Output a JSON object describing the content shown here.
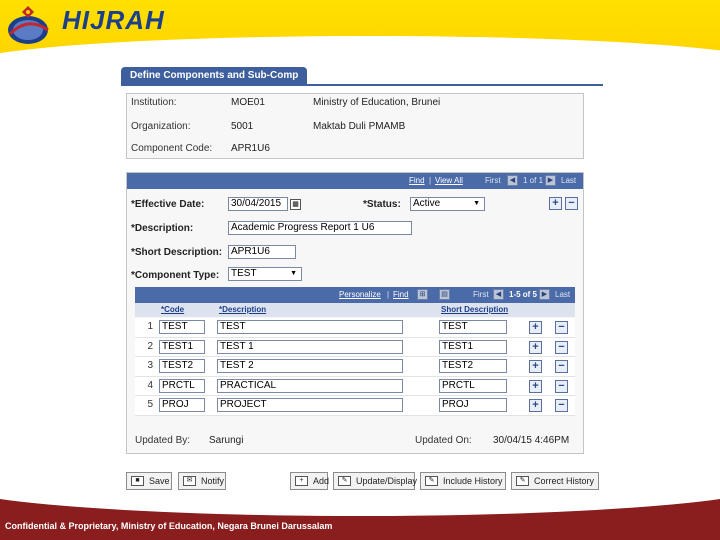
{
  "branding": {
    "logo_text": "HIJRAH",
    "footer_text": "Confidential & Proprietary, Ministry of Education, Negara Brunei Darussalam",
    "colors": {
      "banner": "#ffd400",
      "footer": "#8a1d1d",
      "tab": "#3d5f9e"
    }
  },
  "page": {
    "tab_label": "Define Components and Sub-Comp"
  },
  "keys": {
    "institution_label": "Institution:",
    "institution_code": "MOE01",
    "institution_name": "Ministry of Education, Brunei",
    "organization_label": "Organization:",
    "organization_code": "5001",
    "organization_name": "Maktab Duli PMAMB",
    "component_code_label": "Component Code:",
    "component_code": "APR1U6"
  },
  "effdt_nav": {
    "find": "Find",
    "view_all": "View All",
    "first": "First",
    "counter": "1 of 1",
    "last": "Last"
  },
  "form": {
    "effective_date_label": "*Effective Date:",
    "effective_date": "30/04/2015",
    "status_label": "*Status:",
    "status_value": "Active",
    "description_label": "*Description:",
    "description_value": "Academic Progress Report 1 U6",
    "short_description_label": "*Short Description:",
    "short_description_value": "APR1U6",
    "component_type_label": "*Component Type:",
    "component_type_value": "TEST"
  },
  "grid": {
    "personalize": "Personalize",
    "find": "Find",
    "first": "First",
    "counter": "1-5 of 5",
    "last": "Last",
    "headers": {
      "code": "*Code",
      "description": "*Description",
      "short_description": "Short Description"
    },
    "rows": [
      {
        "num": "1",
        "code": "TEST",
        "description": "TEST",
        "short": "TEST"
      },
      {
        "num": "2",
        "code": "TEST1",
        "description": "TEST 1",
        "short": "TEST1"
      },
      {
        "num": "3",
        "code": "TEST2",
        "description": "TEST 2",
        "short": "TEST2"
      },
      {
        "num": "4",
        "code": "PRCTL",
        "description": "PRACTICAL",
        "short": "PRCTL"
      },
      {
        "num": "5",
        "code": "PROJ",
        "description": "PROJECT",
        "short": "PROJ"
      }
    ]
  },
  "audit": {
    "updated_by_label": "Updated By:",
    "updated_by": "Sarungi",
    "updated_on_label": "Updated On:",
    "updated_on": "30/04/15 4:46PM"
  },
  "toolbar": {
    "save": "Save",
    "notify": "Notify",
    "add": "Add",
    "update_display": "Update/Display",
    "include_history": "Include History",
    "correct_history": "Correct History"
  }
}
